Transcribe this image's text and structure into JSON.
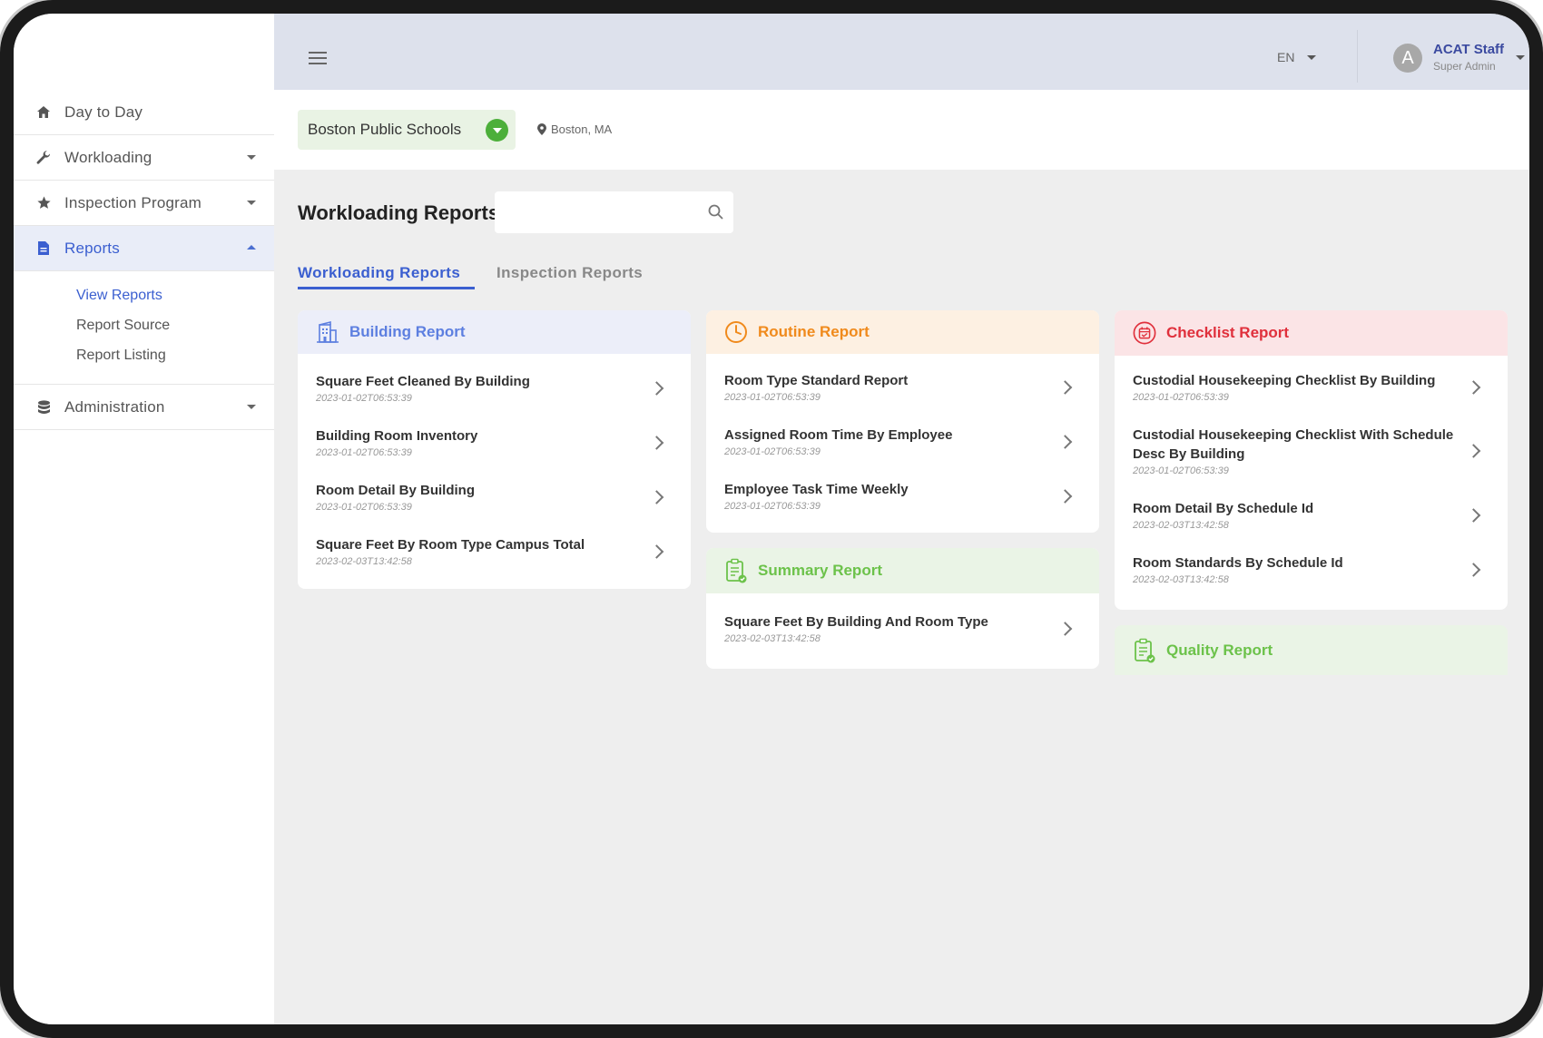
{
  "sidebar": {
    "items": [
      {
        "label": "Day to Day",
        "icon": "home-icon"
      },
      {
        "label": "Workloading",
        "icon": "wrench-icon"
      },
      {
        "label": "Inspection Program",
        "icon": "star-icon"
      },
      {
        "label": "Reports",
        "icon": "document-icon"
      },
      {
        "label": "Administration",
        "icon": "database-icon"
      }
    ],
    "reports_sub": [
      "View Reports",
      "Report Source",
      "Report Listing"
    ]
  },
  "topbar": {
    "language": "EN",
    "user": {
      "initial": "A",
      "name": "ACAT Staff",
      "role": "Super Admin"
    }
  },
  "school": {
    "name": "Boston Public Schools",
    "location": "Boston, MA"
  },
  "main": {
    "title": "Workloading Reports",
    "search": {
      "placeholder": ""
    },
    "tabs": [
      "Workloading Reports",
      "Inspection Reports"
    ]
  },
  "cards": {
    "building": {
      "title": "Building Report",
      "items": [
        {
          "title": "Square Feet Cleaned By Building",
          "date": "2023-01-02T06:53:39"
        },
        {
          "title": "Building Room Inventory",
          "date": "2023-01-02T06:53:39"
        },
        {
          "title": "Room Detail By Building",
          "date": "2023-01-02T06:53:39"
        },
        {
          "title": "Square Feet By Room Type Campus Total",
          "date": "2023-02-03T13:42:58"
        }
      ]
    },
    "routine": {
      "title": "Routine Report",
      "items": [
        {
          "title": "Room Type Standard Report",
          "date": "2023-01-02T06:53:39"
        },
        {
          "title": "Assigned Room Time By Employee",
          "date": "2023-01-02T06:53:39"
        },
        {
          "title": "Employee Task Time Weekly",
          "date": "2023-01-02T06:53:39"
        }
      ]
    },
    "summary": {
      "title": "Summary Report",
      "items": [
        {
          "title": "Square Feet By Building And Room Type",
          "date": "2023-02-03T13:42:58"
        }
      ]
    },
    "checklist": {
      "title": "Checklist Report",
      "items": [
        {
          "title": "Custodial Housekeeping Checklist By Building",
          "date": "2023-01-02T06:53:39"
        },
        {
          "title": "Custodial Housekeeping Checklist With Schedule Desc By Building",
          "date": "2023-01-02T06:53:39"
        },
        {
          "title": "Room Detail By Schedule Id",
          "date": "2023-02-03T13:42:58"
        },
        {
          "title": "Room Standards By Schedule Id",
          "date": "2023-02-03T13:42:58"
        }
      ]
    },
    "quality": {
      "title": "Quality Report"
    }
  },
  "colors": {
    "primary": "#3b5fd0",
    "building_header_bg": "#eceef9",
    "routine_accent": "#f08a1c",
    "routine_header_bg": "#fdf0e2",
    "summary_accent": "#6cc24a",
    "summary_header_bg": "#eaf4e6",
    "checklist_accent": "#e0303c",
    "checklist_header_bg": "#fbe4e6"
  }
}
